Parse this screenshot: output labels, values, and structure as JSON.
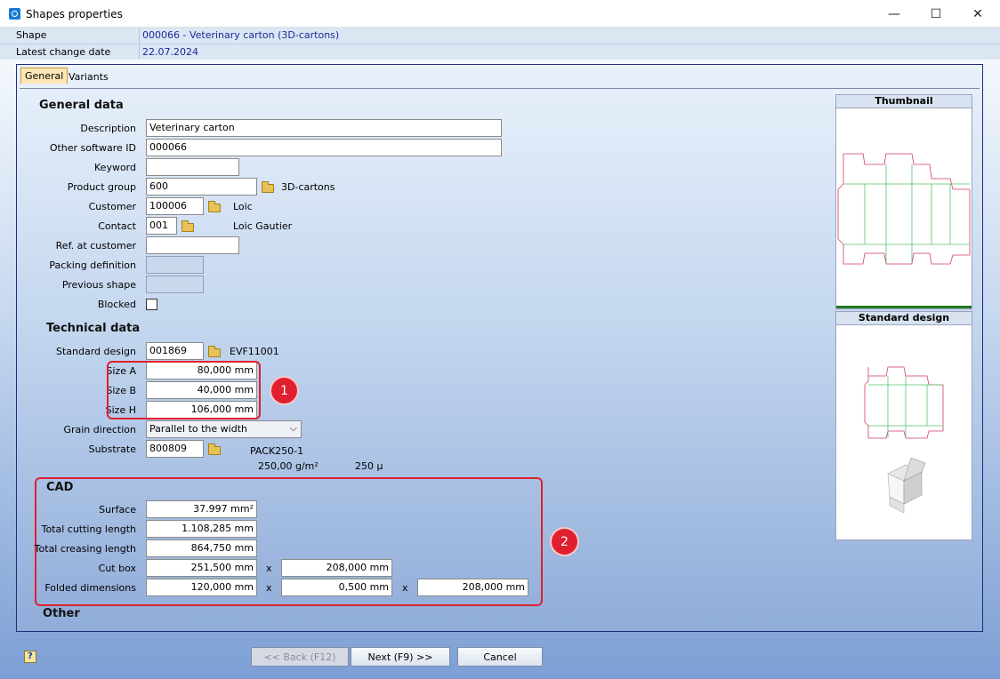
{
  "window": {
    "title": "Shapes properties",
    "minimize": "—",
    "maximize": "☐",
    "close": "✕"
  },
  "info": {
    "shape_label": "Shape",
    "shape_value": "000066 - Veterinary carton (3D-cartons)",
    "date_label": "Latest change date",
    "date_value": "22.07.2024"
  },
  "tabs": [
    "General",
    "Variants"
  ],
  "general": {
    "heading": "General data",
    "description_label": "Description",
    "description_value": "Veterinary carton",
    "other_id_label": "Other software ID",
    "other_id_value": "000066",
    "keyword_label": "Keyword",
    "keyword_value": "",
    "product_group_label": "Product group",
    "product_group_value": "600",
    "product_group_text": "3D-cartons",
    "customer_label": "Customer",
    "customer_value": "100006",
    "customer_text": "Loic",
    "contact_label": "Contact",
    "contact_value": "001",
    "contact_text": "Loic Gautier",
    "ref_label": "Ref. at customer",
    "ref_value": "",
    "packing_label": "Packing definition",
    "previous_label": "Previous shape",
    "blocked_label": "Blocked"
  },
  "technical": {
    "heading": "Technical data",
    "std_design_label": "Standard design",
    "std_design_value": "001869",
    "std_design_text": "EVF11001",
    "size_a_label": "Size A",
    "size_a_value": "80,000 mm",
    "size_b_label": "Size B",
    "size_b_value": "40,000 mm",
    "size_h_label": "Size H",
    "size_h_value": "106,000 mm",
    "grain_label": "Grain direction",
    "grain_value": "Parallel to the width",
    "substrate_label": "Substrate",
    "substrate_value": "800809",
    "substrate_text": "PACK250-1",
    "weight_text": "250,00 g/m²",
    "thickness_text": "250 µ"
  },
  "cad": {
    "heading": "CAD",
    "surface_label": "Surface",
    "surface_value": "37.997 mm²",
    "cutting_label": "Total cutting length",
    "cutting_value": "1.108,285 mm",
    "creasing_label": "Total creasing length",
    "creasing_value": "864,750 mm",
    "cutbox_label": "Cut box",
    "cutbox_x": "251,500 mm",
    "cutbox_y": "208,000 mm",
    "folded_label": "Folded dimensions",
    "folded_x": "120,000 mm",
    "folded_y": "0,500 mm",
    "folded_z": "208,000 mm",
    "times": "x"
  },
  "other_heading": "Other",
  "annotations": {
    "badge1": "1",
    "badge2": "2"
  },
  "panels": {
    "thumbnail": "Thumbnail",
    "standard_design": "Standard design"
  },
  "buttons": {
    "back": "<< Back (F12)",
    "next": "Next (F9) >>",
    "cancel": "Cancel"
  },
  "colors": {
    "accent_red": "#e0202e",
    "cut_line": "#d43a6a",
    "crease_line": "#55c46a"
  }
}
